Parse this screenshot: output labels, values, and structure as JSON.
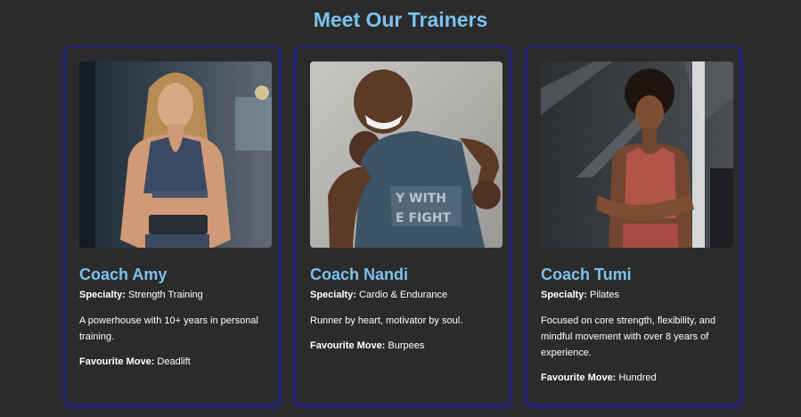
{
  "section": {
    "title": "Meet Our Trainers"
  },
  "trainers": [
    {
      "name": "Coach Amy",
      "specialty_label": "Specialty:",
      "specialty": "Strength Training",
      "description": "A powerhouse with 10+ years in personal training.",
      "move_label": "Favourite Move:",
      "move": "Deadlift"
    },
    {
      "name": "Coach Nandi",
      "specialty_label": "Specialty:",
      "specialty": "Cardio & Endurance",
      "description": "Runner by heart, motivator by soul.",
      "move_label": "Favourite Move:",
      "move": "Burpees"
    },
    {
      "name": "Coach Tumi",
      "specialty_label": "Specialty:",
      "specialty": "Pilates",
      "description": "Focused on core strength, flexibility, and mindful movement with over 8 years of experience.",
      "move_label": "Favourite Move:",
      "move": "Hundred"
    }
  ],
  "colors": {
    "background": "#2b2b2b",
    "accent": "#7cc2ee",
    "card_border": "#21217e",
    "text": "#ffffff"
  }
}
